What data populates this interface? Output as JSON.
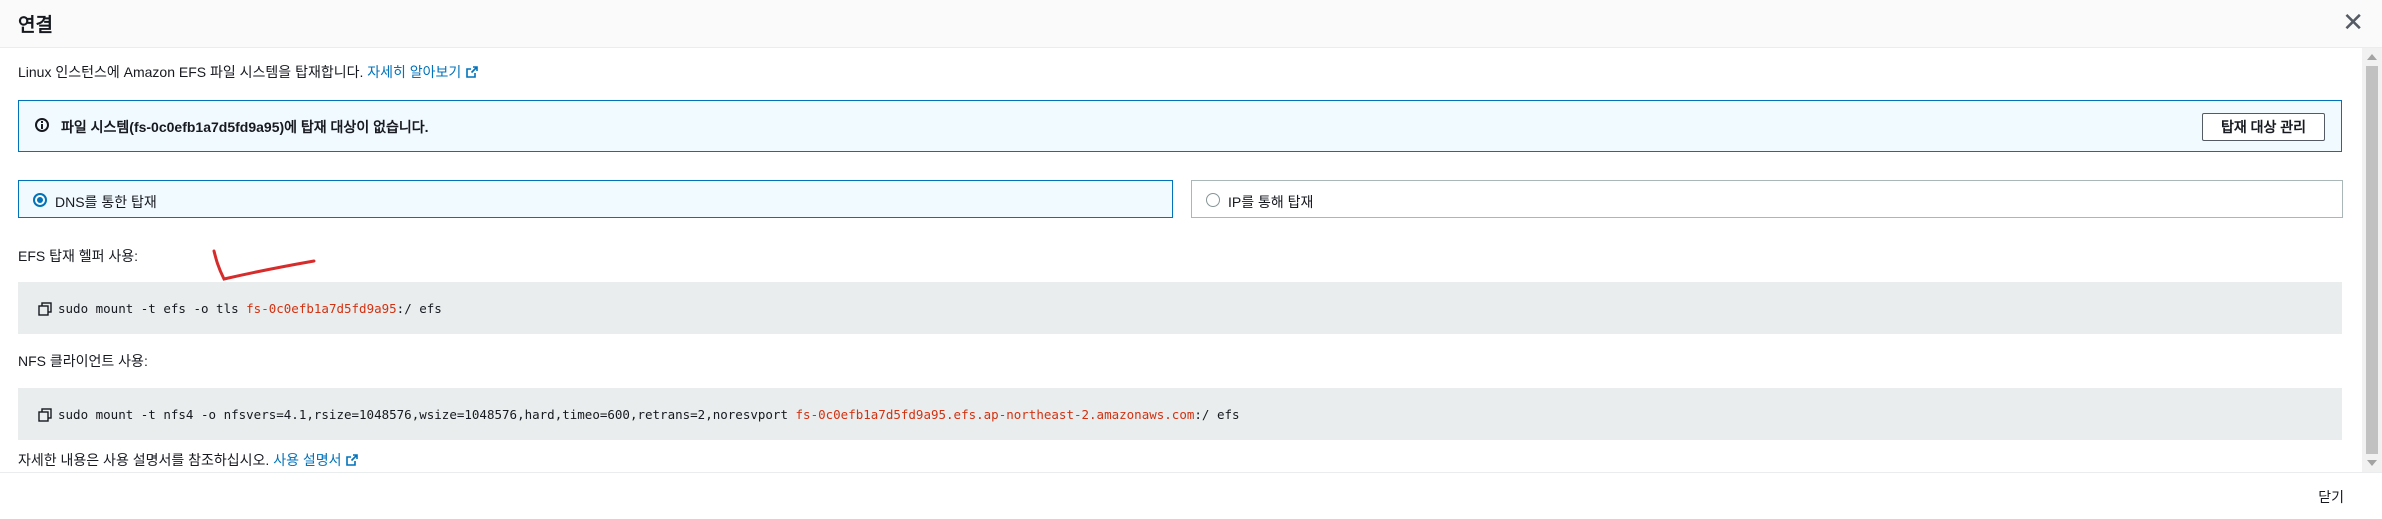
{
  "modal": {
    "title": "연결",
    "close_icon": "close-icon"
  },
  "intro": {
    "text": "Linux 인스턴스에 Amazon EFS 파일 시스템을 탑재합니다. ",
    "learn_more": "자세히 알아보기"
  },
  "alert": {
    "message": "파일 시스템(fs-0c0efb1a7d5fd9a95)에 탑재 대상이 없습니다.",
    "button": "탑재 대상 관리"
  },
  "mount_options": [
    {
      "label": "DNS를 통한 탑재",
      "selected": true
    },
    {
      "label": "IP를 통해 탑재",
      "selected": false
    }
  ],
  "efs_helper": {
    "label": "EFS 탑재 헬퍼 사용:",
    "cmd_prefix": "sudo mount -t efs -o tls ",
    "cmd_highlight": "fs-0c0efb1a7d5fd9a95",
    "cmd_suffix": ":/ efs"
  },
  "nfs_client": {
    "label": "NFS 클라이언트 사용:",
    "cmd_prefix": "sudo mount -t nfs4 -o nfsvers=4.1,rsize=1048576,wsize=1048576,hard,timeo=600,retrans=2,noresvport ",
    "cmd_highlight": "fs-0c0efb1a7d5fd9a95.efs.ap-northeast-2.amazonaws.com",
    "cmd_suffix": ":/ efs"
  },
  "guide": {
    "text": "자세한 내용은 사용 설명서를 참조하십시오. ",
    "link": "사용 설명서"
  },
  "footer": {
    "close_label": "닫기"
  },
  "colors": {
    "accent": "#0073bb",
    "code_highlight": "#d13212",
    "annotation": "#d62c2c"
  }
}
